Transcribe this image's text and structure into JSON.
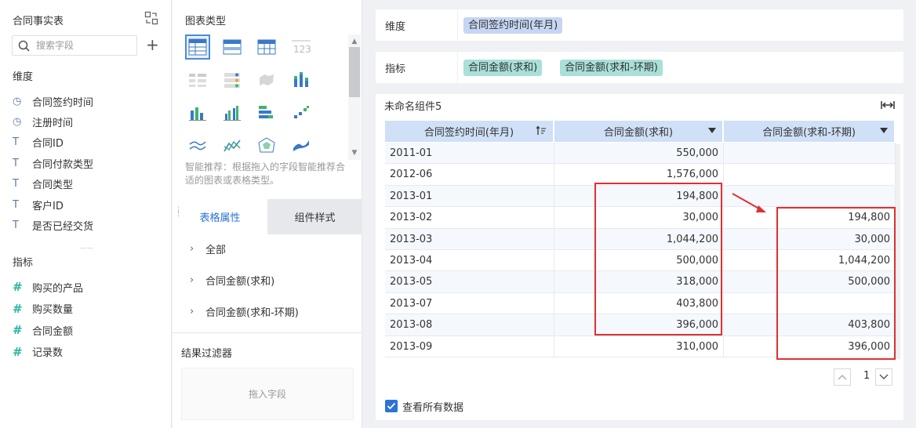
{
  "left_panel": {
    "title": "合同事实表",
    "search_placeholder": "搜索字段",
    "add_label": "+",
    "dimensions_label": "维度",
    "dimensions": [
      {
        "icon": "clock-icon",
        "glyph": "◷",
        "label": "合同签约时间"
      },
      {
        "icon": "clock-icon",
        "glyph": "◷",
        "label": "注册时间"
      },
      {
        "icon": "text-type-icon",
        "glyph": "T",
        "label": "合同ID"
      },
      {
        "icon": "text-type-icon",
        "glyph": "T",
        "label": "合同付款类型"
      },
      {
        "icon": "text-type-icon",
        "glyph": "T",
        "label": "合同类型"
      },
      {
        "icon": "text-type-icon",
        "glyph": "T",
        "label": "客户ID"
      },
      {
        "icon": "text-type-icon",
        "glyph": "T",
        "label": "是否已经交货"
      }
    ],
    "metrics_label": "指标",
    "metrics": [
      {
        "icon": "number-type-icon",
        "glyph": "#",
        "label": "购买的产品"
      },
      {
        "icon": "number-type-icon",
        "glyph": "#",
        "label": "购买数量"
      },
      {
        "icon": "number-type-icon",
        "glyph": "#",
        "label": "合同金额"
      },
      {
        "icon": "count-type-icon",
        "glyph": "#",
        "label": "记录数"
      }
    ]
  },
  "mid_panel": {
    "chart_type_title": "图表类型",
    "hint": "智能推荐：根据拖入的字段智能推荐合适的图表或表格类型。",
    "tabs": [
      {
        "label": "表格属性",
        "active": true
      },
      {
        "label": "组件样式",
        "active": false
      }
    ],
    "properties": [
      "全部",
      "合同金额(求和)",
      "合同金额(求和-环期)"
    ],
    "filter_title": "结果过滤器",
    "drop_placeholder": "拖入字段"
  },
  "right_panel": {
    "dimension_row": {
      "label": "维度",
      "pills": [
        "合同签约时间(年月)"
      ]
    },
    "metric_row": {
      "label": "指标",
      "pills": [
        "合同金额(求和)",
        "合同金额(求和-环期)"
      ]
    },
    "widget_title": "未命名组件5",
    "table": {
      "columns": [
        "合同签约时间(年月)",
        "合同金额(求和)",
        "合同金额(求和-环期)"
      ],
      "rows": [
        [
          "2011-01",
          "550,000",
          ""
        ],
        [
          "2012-06",
          "1,576,000",
          ""
        ],
        [
          "2013-01",
          "194,800",
          ""
        ],
        [
          "2013-02",
          "30,000",
          "194,800"
        ],
        [
          "2013-03",
          "1,044,200",
          "30,000"
        ],
        [
          "2013-04",
          "500,000",
          "1,044,200"
        ],
        [
          "2013-05",
          "318,000",
          "500,000"
        ],
        [
          "2013-07",
          "403,800",
          ""
        ],
        [
          "2013-08",
          "396,000",
          "403,800"
        ],
        [
          "2013-09",
          "310,000",
          "396,000"
        ]
      ]
    },
    "page_number": "1",
    "show_all_label": "查看所有数据"
  },
  "colors": {
    "accent": "#2b73d8",
    "dimension_pill": "#c6d6f3",
    "metric_pill": "#a9e0d8",
    "table_header": "#cfe0f7",
    "highlight_box": "#e03030"
  }
}
